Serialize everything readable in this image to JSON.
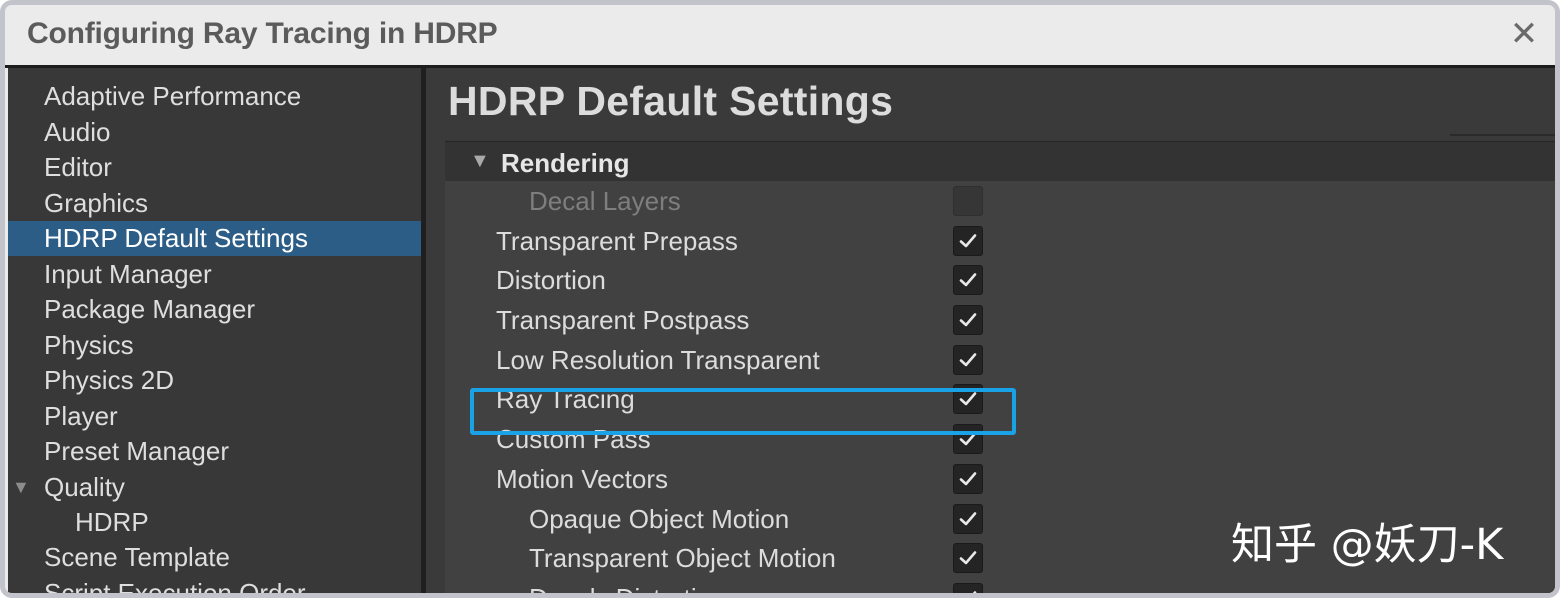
{
  "window": {
    "title": "Configuring Ray Tracing in HDRP",
    "close_glyph": "✕"
  },
  "sidebar": {
    "items": [
      {
        "label": "Adaptive Performance"
      },
      {
        "label": "Audio"
      },
      {
        "label": "Editor"
      },
      {
        "label": "Graphics"
      },
      {
        "label": "HDRP Default Settings",
        "selected": true
      },
      {
        "label": "Input Manager"
      },
      {
        "label": "Package Manager"
      },
      {
        "label": "Physics"
      },
      {
        "label": "Physics 2D"
      },
      {
        "label": "Player"
      },
      {
        "label": "Preset Manager"
      },
      {
        "label": "Quality",
        "expanded": true
      },
      {
        "label": "HDRP",
        "child": true
      },
      {
        "label": "Scene Template"
      },
      {
        "label": "Script Execution Order"
      }
    ]
  },
  "main": {
    "title": "HDRP Default Settings",
    "section": {
      "label": "Rendering",
      "expanded": true,
      "rows": [
        {
          "label": "Decal Layers",
          "checked": false,
          "disabled": true
        },
        {
          "label": "Transparent Prepass",
          "checked": true
        },
        {
          "label": "Distortion",
          "checked": true
        },
        {
          "label": "Transparent Postpass",
          "checked": true
        },
        {
          "label": "Low Resolution Transparent",
          "checked": true
        },
        {
          "label": "Ray Tracing",
          "checked": true,
          "highlighted": true
        },
        {
          "label": "Custom Pass",
          "checked": true
        },
        {
          "label": "Motion Vectors",
          "checked": true
        },
        {
          "label": "Opaque Object Motion",
          "checked": true
        },
        {
          "label": "Transparent Object Motion",
          "checked": true
        },
        {
          "label": "Decals Distortion",
          "checked": true
        }
      ]
    }
  },
  "watermark": "知乎 @妖刀-K",
  "colors": {
    "selection": "#2c5d87",
    "highlight_outline": "#19a3e6"
  },
  "icons": {
    "close": "close-icon",
    "foldout": "triangle-down-icon",
    "check": "checkmark-icon"
  }
}
